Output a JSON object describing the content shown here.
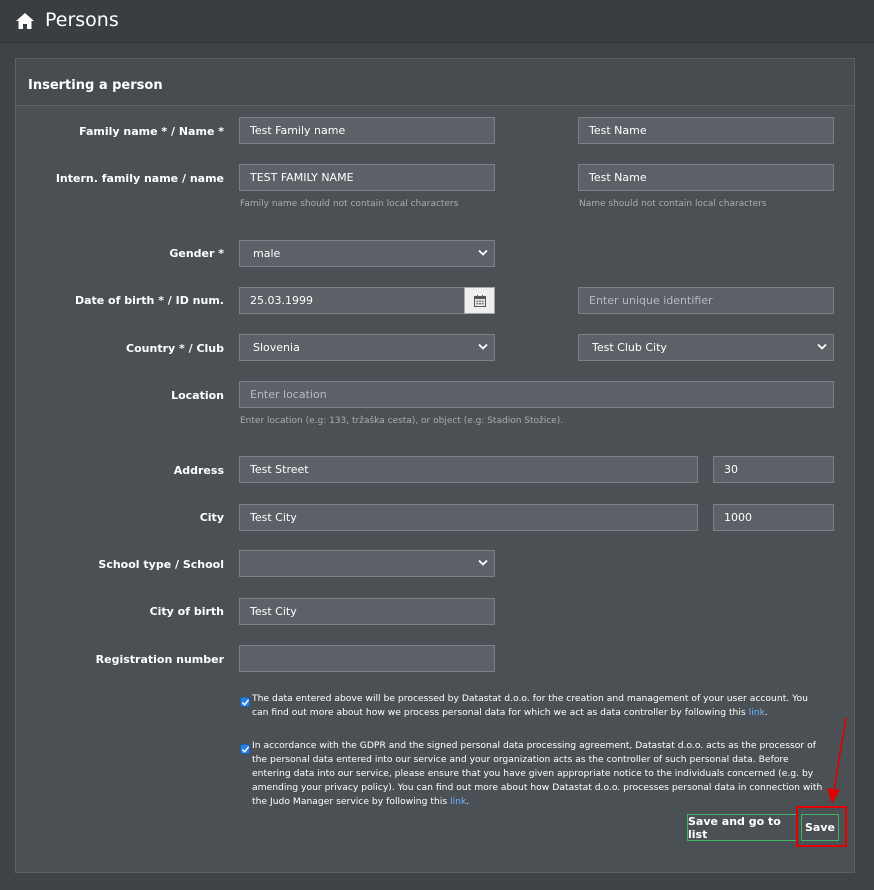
{
  "header": {
    "title": "Persons",
    "home_icon": "home-icon"
  },
  "panel": {
    "title": "Inserting a person"
  },
  "form": {
    "family_name": {
      "label": "Family name * / Name *",
      "family_value": "Test Family name",
      "name_value": "Test Name"
    },
    "intern_name": {
      "label": "Intern. family name / name",
      "family_value": "TEST FAMILY NAME",
      "name_value": "Test Name",
      "family_help": "Family name should not contain local characters",
      "name_help": "Name should not contain local characters"
    },
    "gender": {
      "label": "Gender *",
      "value": "male"
    },
    "dob": {
      "label": "Date of birth * / ID num.",
      "value": "25.03.1999",
      "id_placeholder": "Enter unique identifier"
    },
    "country": {
      "label": "Country * / Club",
      "country_value": "Slovenia",
      "club_value": "Test Club City"
    },
    "location": {
      "label": "Location",
      "placeholder": "Enter location",
      "help": "Enter location (e.g: 133, tržaška cesta), or object (e.g: Stadion Stožice)."
    },
    "address": {
      "label": "Address",
      "street": "Test Street",
      "number": "30"
    },
    "city": {
      "label": "City",
      "value": "Test City",
      "postal": "1000"
    },
    "school": {
      "label": "School type / School",
      "value": ""
    },
    "city_of_birth": {
      "label": "City of birth",
      "value": "Test City"
    },
    "registration": {
      "label": "Registration number",
      "value": ""
    }
  },
  "consent": {
    "first": {
      "text": "The data entered above will be processed by Datastat d.o.o. for the creation and management of your user account. You can find out more about how we process personal data for which we act as data controller by following this ",
      "link": "link",
      "end": "."
    },
    "second": {
      "text": "In accordance with the GDPR and the signed personal data processing agreement, Datastat d.o.o. acts as the processor of the personal data entered into our service and your organization acts as the controller of such personal data. Before entering data into our service, please ensure that you have given appropriate notice to the individuals concerned (e.g. by amending your privacy policy). You can find out more about how Datastat d.o.o. processes personal data in connection with the Judo Manager service by following this ",
      "link": "link",
      "end": "."
    }
  },
  "buttons": {
    "save_and_list": "Save and go to list",
    "save": "Save"
  },
  "colors": {
    "accent_green": "#3fb56a",
    "highlight_red": "#e00000",
    "link_blue": "#6cb4ff"
  }
}
